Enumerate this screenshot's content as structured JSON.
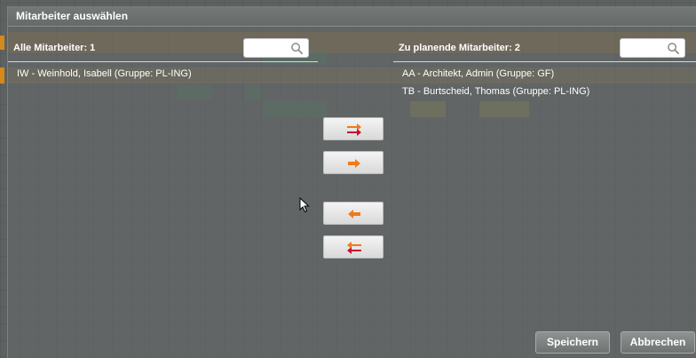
{
  "dialog": {
    "title": "Mitarbeiter auswählen"
  },
  "left_panel": {
    "header": "Alle Mitarbeiter: 1",
    "search_placeholder": "",
    "items": [
      {
        "label": "IW - Weinhold, Isabell (Gruppe: PL-ING)"
      }
    ]
  },
  "right_panel": {
    "header": "Zu planende Mitarbeiter: 2",
    "search_placeholder": "",
    "items": [
      {
        "label": "AA - Architekt, Admin (Gruppe: GF)"
      },
      {
        "label": "TB - Burtscheid, Thomas (Gruppe: PL-ING)"
      }
    ]
  },
  "transfer_buttons": [
    {
      "icon": "move-all-right-icon"
    },
    {
      "icon": "move-right-icon"
    },
    {
      "icon": "move-left-icon"
    },
    {
      "icon": "move-all-left-icon"
    }
  ],
  "footer": {
    "save_label": "Speichern",
    "cancel_label": "Abbrechen"
  },
  "colors": {
    "arrow_orange": "#f07a1a",
    "arrow_red": "#c8102e",
    "accent": "#d48a1c"
  }
}
